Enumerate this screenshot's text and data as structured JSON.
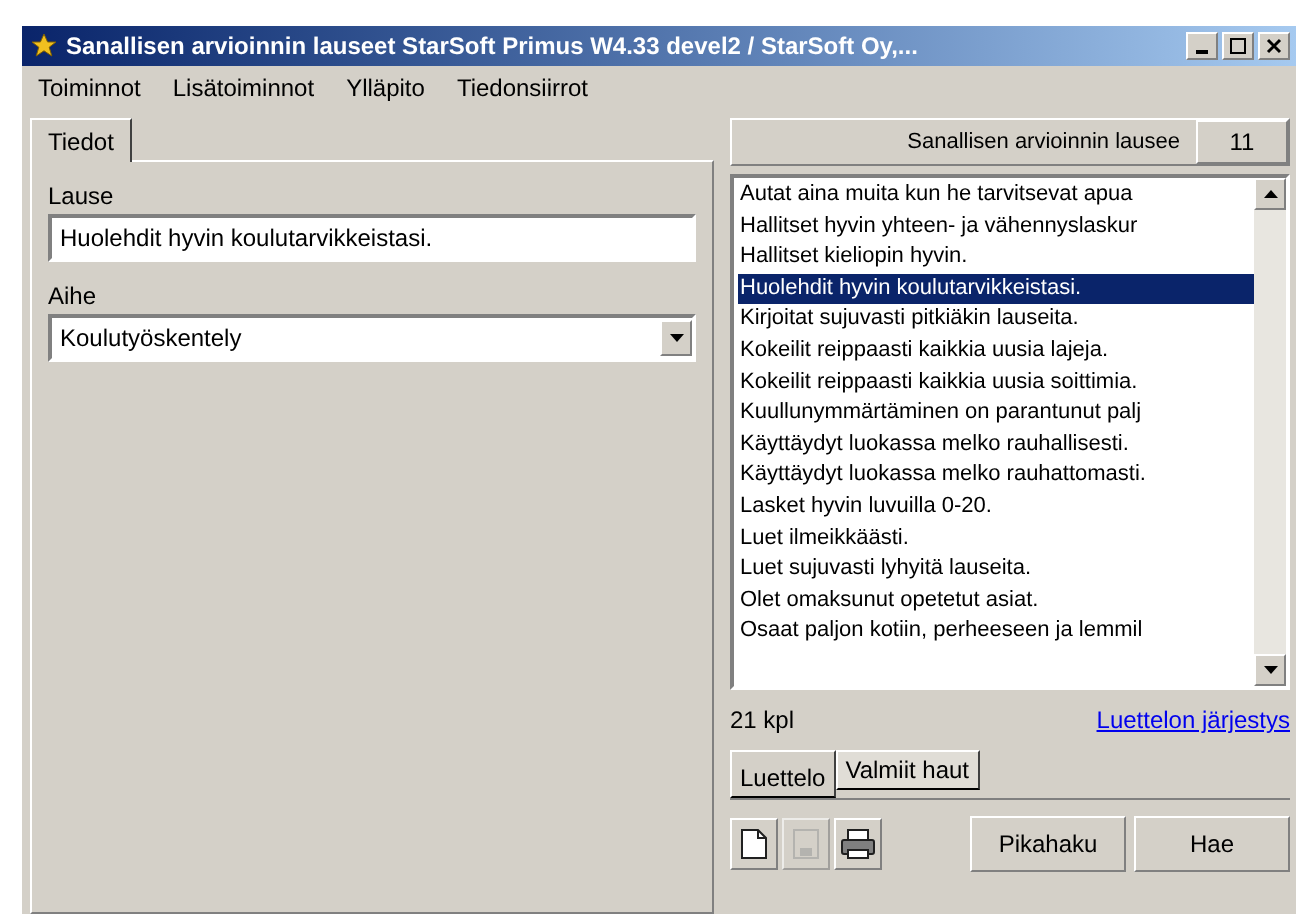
{
  "window": {
    "title": "Sanallisen arvioinnin lauseet StarSoft Primus W4.33 devel2 / StarSoft Oy,..."
  },
  "menu": [
    "Toiminnot",
    "Lisätoiminnot",
    "Ylläpito",
    "Tiedonsiirrot"
  ],
  "left_tabs": [
    {
      "label": "Tiedot",
      "selected": true
    }
  ],
  "form": {
    "lause_label": "Lause",
    "lause_value": "Huolehdit hyvin koulutarvikkeistasi.",
    "aihe_label": "Aihe",
    "aihe_value": "Koulutyöskentely"
  },
  "list_header": {
    "title": "Sanallisen arvioinnin lausee",
    "count": "11"
  },
  "items": [
    {
      "text": "Autat aina muita kun he tarvitsevat apua",
      "selected": false
    },
    {
      "text": "Hallitset hyvin yhteen- ja vähennyslaskur",
      "selected": false
    },
    {
      "text": "Hallitset kieliopin hyvin.",
      "selected": false
    },
    {
      "text": "Huolehdit hyvin koulutarvikkeistasi.",
      "selected": true
    },
    {
      "text": "Kirjoitat sujuvasti pitkiäkin lauseita.",
      "selected": false
    },
    {
      "text": "Kokeilit reippaasti kaikkia uusia lajeja.",
      "selected": false
    },
    {
      "text": "Kokeilit reippaasti kaikkia uusia soittimia.",
      "selected": false
    },
    {
      "text": "Kuullunymmärtäminen on parantunut palj",
      "selected": false
    },
    {
      "text": "Käyttäydyt luokassa melko rauhallisesti.",
      "selected": false
    },
    {
      "text": "Käyttäydyt luokassa melko rauhattomasti.",
      "selected": false
    },
    {
      "text": "Lasket hyvin luvuilla 0-20.",
      "selected": false
    },
    {
      "text": "Luet ilmeikkäästi.",
      "selected": false
    },
    {
      "text": "Luet sujuvasti lyhyitä lauseita.",
      "selected": false
    },
    {
      "text": "Olet omaksunut opetetut asiat.",
      "selected": false
    },
    {
      "text": "Osaat paljon kotiin, perheeseen ja lemmil",
      "selected": false
    }
  ],
  "count_text": "21 kpl",
  "sort_link": "Luettelon järjestys",
  "bottom_tabs": [
    {
      "label": "Luettelo",
      "selected": true
    },
    {
      "label": "Valmiit haut",
      "selected": false
    }
  ],
  "toolbar": [
    {
      "kind": "new",
      "disabled": false
    },
    {
      "kind": "save",
      "disabled": true
    },
    {
      "kind": "print",
      "disabled": false
    }
  ],
  "buttons": [
    "Pikahaku",
    "Hae"
  ]
}
